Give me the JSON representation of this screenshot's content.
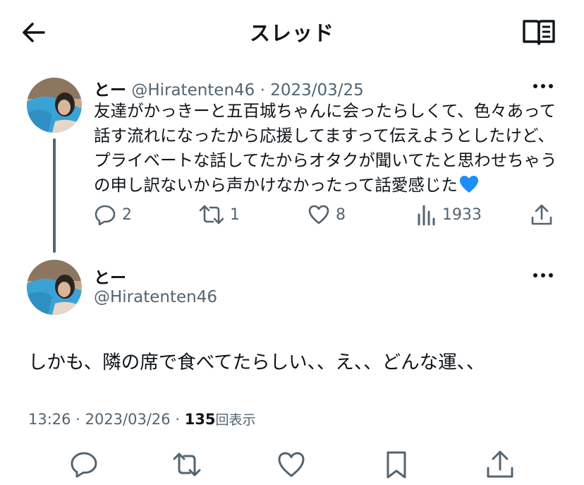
{
  "header": {
    "title": "スレッド",
    "back_icon": "arrow-left-icon",
    "reader_icon": "open-book-icon"
  },
  "tweet1": {
    "display_name": "とー",
    "handle": "@Hiratenten46",
    "separator": "·",
    "date": "2023/03/25",
    "text": "友達がかっきーと五百城ちゃんに会ったらしくて、色々あって話す流れになったから応援してますって伝えようとしたけど、プライベートな話してたからオタクが聞いてたと思わせちゃうの申し訳ないから声かけなかったって話愛感じた",
    "emoji": "blue-heart",
    "actions": {
      "replies": "2",
      "retweets": "1",
      "likes": "8",
      "views": "1933"
    }
  },
  "tweet2": {
    "display_name": "とー",
    "handle": "@Hiratenten46",
    "text": "しかも、隣の席で食べてたらしい、、え、、どんな運、、",
    "time": "13:26",
    "separator": "·",
    "date": "2023/03/26",
    "view_count": "135",
    "view_label": "回表示"
  },
  "colors": {
    "text": "#0f1419",
    "muted": "#536471",
    "thread_line": "#536471",
    "heart_emoji": "#1d8ef5"
  }
}
